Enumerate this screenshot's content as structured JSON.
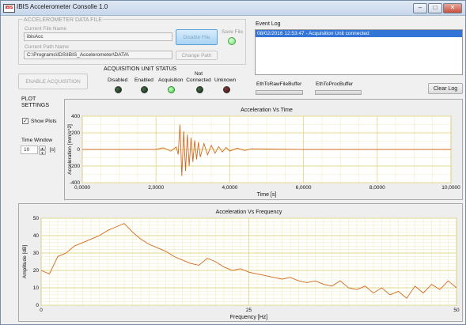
{
  "window": {
    "title": "IBIS Accelerometer Consolle 1.0",
    "icon_text": "IBIS",
    "controls": {
      "minimize": "–",
      "maximize": "□",
      "close": "✕"
    }
  },
  "file_panel": {
    "title": "ACCELEROMETER DATA FILE",
    "file_name_label": "Current File Name",
    "file_name_value": "ibisAcc",
    "path_label": "Current Path Name",
    "path_value": "C:\\Programs\\IDS\\IBIS_Accelerometer\\DATA\\",
    "disable_file_label": "Disable File",
    "change_path_label": "Change Path",
    "save_file_label": "Save File"
  },
  "acquisition": {
    "enable_label": "ENABLE ACQUISITION",
    "status_title": "ACQUISITION UNIT STATUS",
    "status_items": [
      {
        "label": "Disabled",
        "state": "off-green"
      },
      {
        "label": "Enabled",
        "state": "off-green"
      },
      {
        "label": "Acquisition",
        "state": "on-green"
      },
      {
        "label": "Not Connected",
        "state": "off-green"
      },
      {
        "label": "Unknown",
        "state": "off-red"
      }
    ]
  },
  "event_log": {
    "title": "Event Log",
    "entries": [
      "08/02/2016 12:53:47 - Acquisition Unit connected"
    ],
    "buffer1_label": "EthToRawFileBuffer",
    "buffer2_label": "EthToProcBuffer",
    "clear_label": "Clear Log"
  },
  "plot_settings": {
    "title_line1": "PLOT",
    "title_line2": "SETTINGS",
    "show_plots_label": "Show Plots",
    "show_plots_checked": true,
    "check_mark": "✓",
    "time_window_label": "Time Window",
    "time_window_value": "10",
    "time_window_unit": "[s]",
    "spinner_up": "▲",
    "spinner_down": "▼"
  },
  "colors": {
    "plot_line": "#d2691e",
    "grid": "#e6d98a",
    "plot_bg": "#ffffff"
  },
  "chart_data": [
    {
      "type": "line",
      "title": "Acceleration Vs Time",
      "xlabel": "Time [s]",
      "ylabel": "Acceleration [mm/s^2]",
      "xlim": [
        0,
        10
      ],
      "ylim": [
        -400,
        400
      ],
      "x_ticks": [
        "0,0000",
        "2,0000",
        "4,0000",
        "6,0000",
        "8,0000",
        "10,0000"
      ],
      "y_ticks": [
        "400",
        "200",
        "0",
        "-200",
        "-400"
      ],
      "series": [
        {
          "x": [
            0,
            2.0,
            2.2,
            2.4,
            2.55,
            2.6,
            2.65,
            2.7,
            2.75,
            2.8,
            2.85,
            2.9,
            2.95,
            3.0,
            3.05,
            3.1,
            3.15,
            3.2,
            3.3,
            3.4,
            3.5,
            3.6,
            3.7,
            3.8,
            3.9,
            4.0,
            4.2,
            4.4,
            4.6,
            5.0,
            6.0,
            7.0,
            8.0,
            9.0,
            10.0
          ],
          "y": [
            0,
            0,
            20,
            -20,
            30,
            -60,
            300,
            -320,
            220,
            -260,
            180,
            -200,
            140,
            -150,
            110,
            -120,
            90,
            -90,
            70,
            -65,
            50,
            -45,
            35,
            -30,
            25,
            -20,
            15,
            -12,
            8,
            5,
            0,
            0,
            0,
            0,
            0
          ]
        }
      ]
    },
    {
      "type": "line",
      "title": "Acceleration Vs Frequency",
      "xlabel": "Frequency [Hz]",
      "ylabel": "Amplitude [dB]",
      "xlim": [
        0,
        50
      ],
      "ylim": [
        0,
        50
      ],
      "x_ticks": [
        "0",
        "25",
        "50"
      ],
      "y_ticks": [
        "50",
        "40",
        "30",
        "20",
        "10",
        "0"
      ],
      "series": [
        {
          "x": [
            0,
            1,
            2,
            3,
            4,
            5,
            6,
            7,
            8,
            9,
            10,
            11,
            12,
            13,
            14,
            15,
            16,
            17,
            18,
            19,
            20,
            21,
            22,
            23,
            24,
            25,
            26,
            27,
            28,
            29,
            30,
            31,
            32,
            33,
            34,
            35,
            36,
            37,
            38,
            39,
            40,
            41,
            42,
            43,
            44,
            45,
            46,
            47,
            48,
            49,
            50
          ],
          "y": [
            20,
            18,
            28,
            30,
            34,
            36,
            38,
            40,
            43,
            45,
            47,
            42,
            38,
            35,
            33,
            31,
            28,
            26,
            24,
            23,
            27,
            25,
            22,
            20,
            21,
            19,
            18,
            17,
            16,
            15,
            16,
            14,
            13,
            14,
            12,
            11,
            14,
            10,
            9,
            11,
            7,
            10,
            6,
            8,
            4,
            11,
            7,
            12,
            9,
            14,
            10
          ]
        }
      ]
    }
  ]
}
